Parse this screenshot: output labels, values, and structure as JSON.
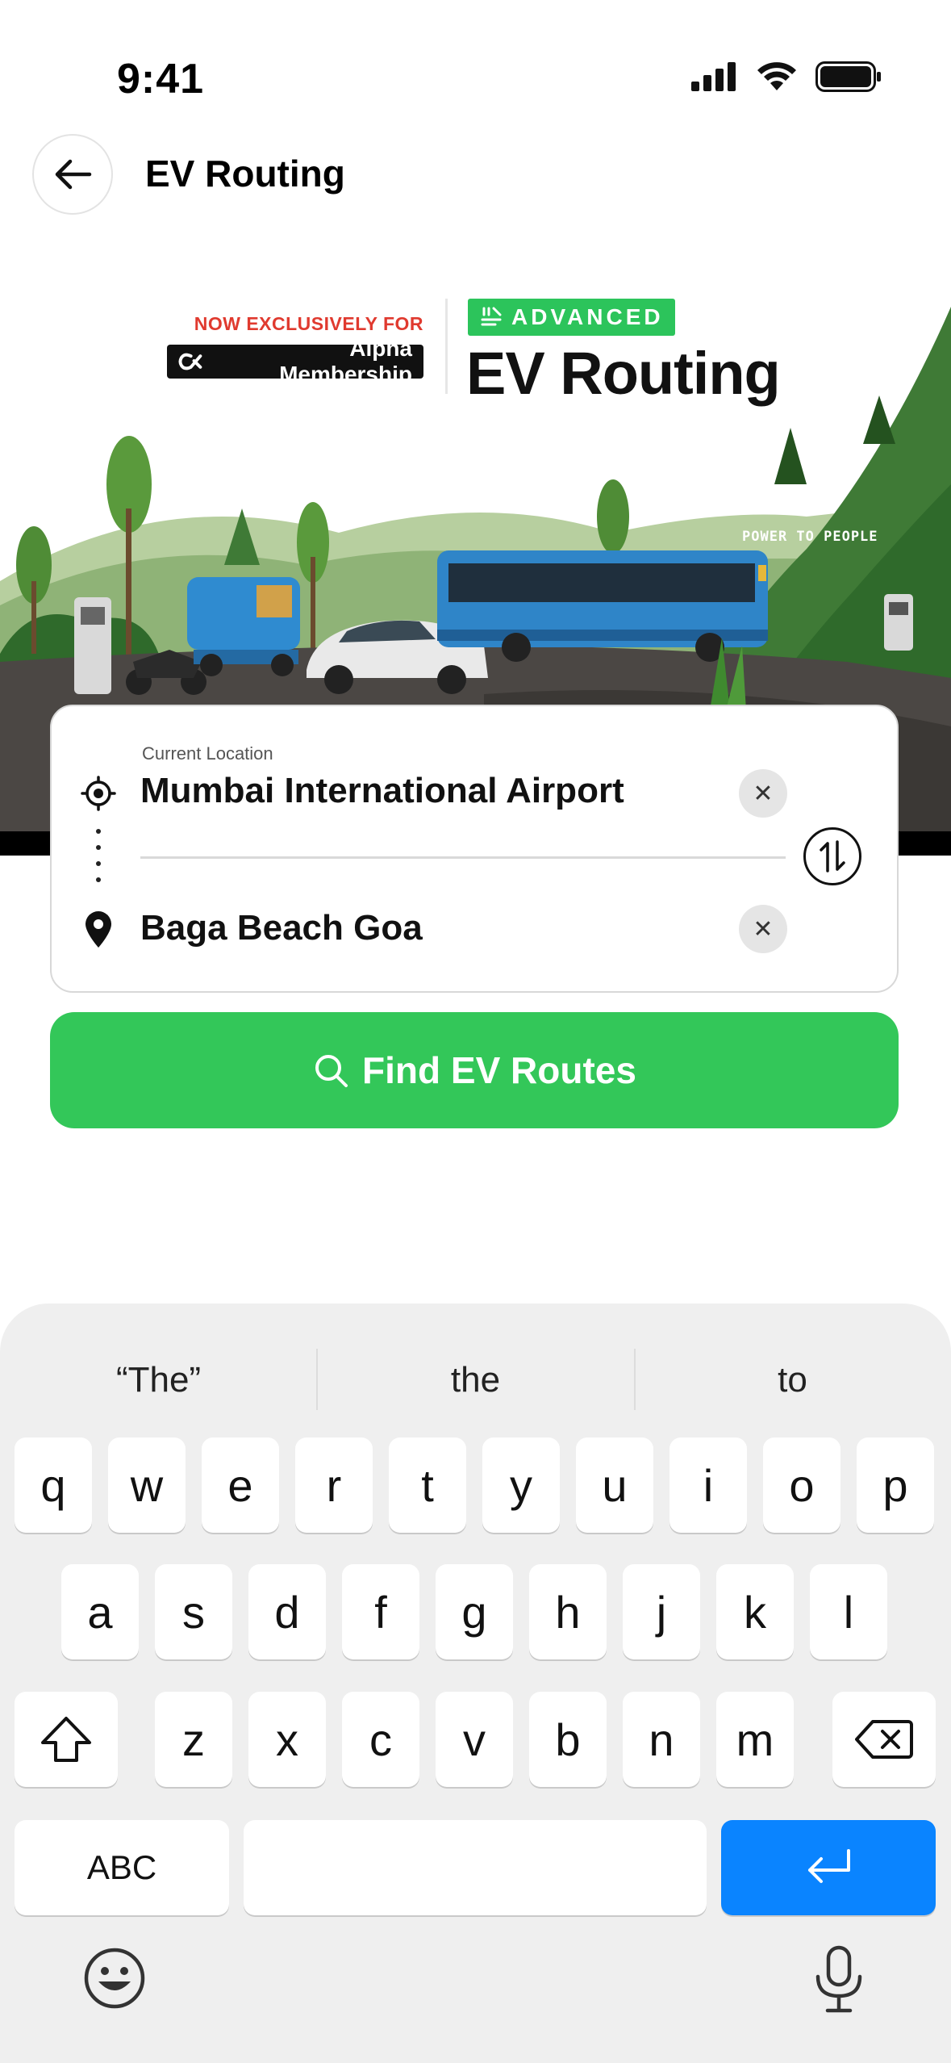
{
  "status_bar": {
    "time": "9:41"
  },
  "header": {
    "title": "EV Routing"
  },
  "promo": {
    "exclusive_text": "NOW EXCLUSIVELY FOR",
    "membership_label": "Alpha Membership",
    "badge_label": "ADVANCED",
    "title": "EV Routing",
    "scene_text": "POWER TO PEOPLE"
  },
  "route_form": {
    "origin_caption": "Current Location",
    "origin_value": "Mumbai International Airport",
    "destination_value": "Baga Beach Goa",
    "clear_symbol": "✕"
  },
  "find_button": {
    "label": "Find EV Routes"
  },
  "keyboard": {
    "suggestions": [
      "“The”",
      "the",
      "to"
    ],
    "rows": [
      [
        "q",
        "w",
        "e",
        "r",
        "t",
        "y",
        "u",
        "i",
        "o",
        "p"
      ],
      [
        "a",
        "s",
        "d",
        "f",
        "g",
        "h",
        "j",
        "k",
        "l"
      ],
      [
        "z",
        "x",
        "c",
        "v",
        "b",
        "n",
        "m"
      ]
    ],
    "abc_label": "ABC"
  },
  "colors": {
    "accent_green": "#33c759",
    "badge_green": "#2cc45b",
    "return_blue": "#0a84ff",
    "exclusive_red": "#e03a2f"
  }
}
